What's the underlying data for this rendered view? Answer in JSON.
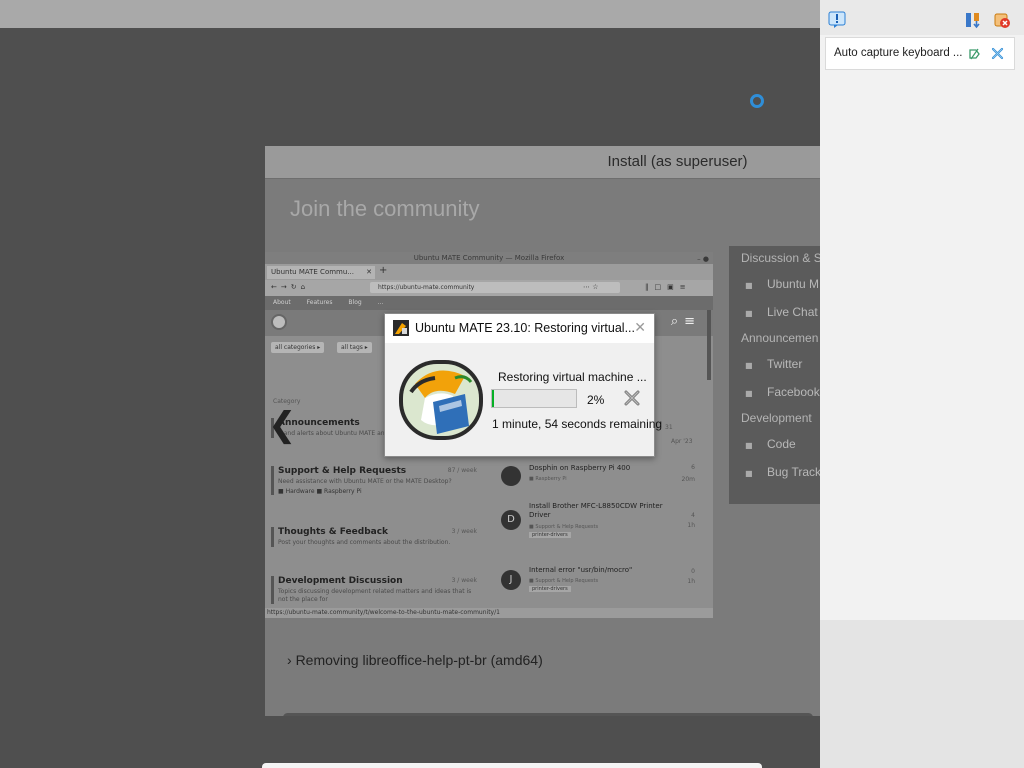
{
  "installer": {
    "title": "Install (as superuser)",
    "slide_heading": "Join the community",
    "progress_label": "Removing libreoffice-help-pt-br (amd64)",
    "back_glyph": "❮"
  },
  "browser": {
    "window_title": "Ubuntu MATE Community — Mozilla Firefox",
    "tab_label": "Ubuntu MATE Commu...",
    "url": "https://ubuntu-mate.community",
    "site_nav": [
      "About",
      "Features",
      "Blog",
      "..."
    ],
    "filters": [
      "all categories ▸",
      "all tags ▸"
    ],
    "column_header": "Category",
    "categories": [
      {
        "name": "Announcements",
        "desc": "...and alerts about Ubuntu MATE and community updates",
        "count": ""
      },
      {
        "name": "Support & Help Requests",
        "desc": "Need assistance with Ubuntu MATE or the MATE Desktop?",
        "count": "87 / week",
        "tags": "■ Hardware  ■ Raspberry Pi"
      },
      {
        "name": "Thoughts & Feedback",
        "desc": "Post your thoughts and comments about the distribution.",
        "count": "3 / week"
      },
      {
        "name": "Development Discussion",
        "desc": "Topics discussing development related matters and ideas that is not the place for",
        "count": "3 / week"
      }
    ],
    "topics": [
      {
        "title": "Dosphin on Raspberry Pi 400",
        "meta": "■ Raspberry Pi",
        "count": "6",
        "ago": "20m",
        "avatar": ""
      },
      {
        "title": "Install Brother MFC-L8850CDW Printer Driver",
        "meta": "■ Support & Help Requests",
        "tag": "printer-drivers",
        "count": "4",
        "ago": "1h",
        "avatar": "D"
      },
      {
        "title": "Internal error \"usr/bin/mocro\"",
        "meta": "■ Support & Help Requests",
        "tag": "printer-drivers",
        "count": "0",
        "ago": "1h",
        "avatar": "J"
      }
    ],
    "top_right_count": "31",
    "top_right_ago": "Apr '23",
    "status_url": "https://ubuntu-mate.community/t/welcome-to-the-ubuntu-mate-community/1"
  },
  "community": {
    "sections": [
      {
        "title": "Discussion & S",
        "items": [
          "Ubuntu M",
          "Live Chat"
        ]
      },
      {
        "title": "Announcemen",
        "items": [
          "Twitter",
          "Facebook"
        ]
      },
      {
        "title": "Development",
        "items": [
          "Code",
          "Bug Track"
        ]
      }
    ]
  },
  "dialog": {
    "title": "Ubuntu MATE 23.10: Restoring virtual...",
    "status": "Restoring virtual machine ...",
    "percent_label": "2%",
    "progress_fraction": 0.02,
    "remaining": "1 minute, 54 seconds remaining",
    "close_glyph": "✕"
  },
  "vbox": {
    "notice_text": "Auto capture keyboard ...",
    "icons": [
      "info-icon",
      "tasks-icon",
      "close-all-icon",
      "pin-icon",
      "dismiss-icon"
    ]
  },
  "colors": {
    "accent": "#2f8ed8",
    "progress_fill": "#06b025"
  }
}
